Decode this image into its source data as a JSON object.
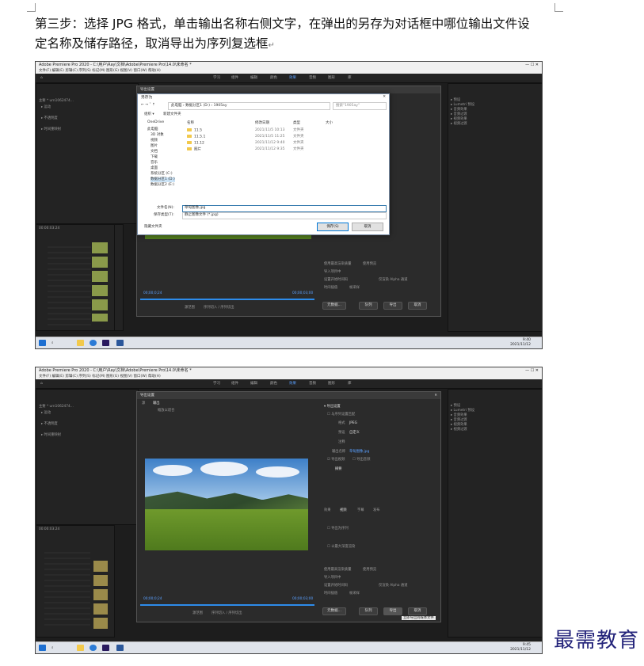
{
  "document": {
    "step_text_line1": "第三步：选择 JPG 格式，单击输出名称右侧文字，在弹出的另存为对话框中哪位输出文件设",
    "step_text_line2": "定名称及储存路径，取消导出为序列复选框",
    "pilcrow": "↵"
  },
  "screenshot1": {
    "window_title": "Adobe Premiere Pro 2020 - C:\\用户\\Ray\\文档\\Adobe\\Premiere Pro\\14.0\\未命名 *",
    "menu": "文件(F)  编辑(E)  剪辑(C)  序列(S)  标记(M)  图形(G)  视图(V)  窗口(W)  帮助(H)",
    "workspace_tabs": [
      "学习",
      "组件",
      "编辑",
      "颜色",
      "效果",
      "音频",
      "图形",
      "库"
    ],
    "active_tab": "效果",
    "save_dialog": {
      "title": "另存为",
      "breadcrumb": "此电脑 › 数据分区1 (D:) › 1905ay",
      "search_placeholder": "搜索\"1905ay\"",
      "organize": "组织 ▾",
      "new_folder": "新建文件夹",
      "nav_items": [
        "OneDrive",
        "此电脑",
        "3D 对象",
        "视频",
        "图片",
        "文档",
        "下载",
        "音乐",
        "桌面",
        "系统分区 (C:)",
        "数据分区1 (D:)",
        "数据分区2 (E:)"
      ],
      "columns": [
        "名称",
        "修改日期",
        "类型",
        "大小"
      ],
      "rows": [
        {
          "name": "11.5",
          "date": "2021/11/5 10:13",
          "type": "文件夹"
        },
        {
          "name": "11.5.1",
          "date": "2021/11/5 11:25",
          "type": "文件夹"
        },
        {
          "name": "11.12",
          "date": "2021/11/12 9:40",
          "type": "文件夹"
        },
        {
          "name": "图片",
          "date": "2021/11/12 9:35",
          "type": "文件夹"
        }
      ],
      "filename_label": "文件名(N):",
      "filename_value": "草甸图像.jpg",
      "filetype_label": "保存类型(T):",
      "filetype_value": "静止图像文件 (*.jpg)",
      "hide_folders": "隐藏文件夹",
      "save_button": "保存(S)",
      "cancel_button": "取消"
    },
    "export_buttons": [
      "元数据...",
      "队列",
      "导出",
      "取消"
    ],
    "timecode_left": "00;00;0;24",
    "timecode_right": "00;00;03;00",
    "range_label": "源范围",
    "range_value": "序列切入 / 序列切出",
    "checkboxes": [
      "使用最高渲染质量",
      "使用预览",
      "导入项目中",
      "设置开始时间码",
      "仅渲染 Alpha 通道"
    ],
    "time_interp_label": "时间插值",
    "time_interp_value": "帧采样",
    "clock_time": "9:40",
    "clock_date": "2021/11/12"
  },
  "screenshot2": {
    "window_title": "Adobe Premiere Pro 2020 - C:\\用户\\Ray\\文档\\Adobe\\Premiere Pro\\14.0\\未命名 *",
    "export_title": "导出设置",
    "source_tab": "源",
    "output_tab": "输出",
    "source_scaling": "缩放以适合",
    "format_label": "格式",
    "format_value": "JPEG",
    "preset_label": "预设",
    "preset_value": "自定义",
    "comments_label": "注释",
    "output_name_label": "输出名称",
    "output_name_value": "草甸图像.jpg",
    "export_video": "导出视频",
    "export_audio": "导出音频",
    "summary_label": "摘要",
    "tabs": [
      "效果",
      "视频",
      "字幕",
      "发布"
    ],
    "export_as_sequence": "导出为序列",
    "use_max_depth": "以最大深度渲染",
    "buttons": [
      "元数据...",
      "队列",
      "导出",
      "取消"
    ],
    "tooltip": "立即导出到媒体文件",
    "clock_time": "9:45",
    "clock_date": "2021/11/12"
  },
  "watermark": "最需教育"
}
